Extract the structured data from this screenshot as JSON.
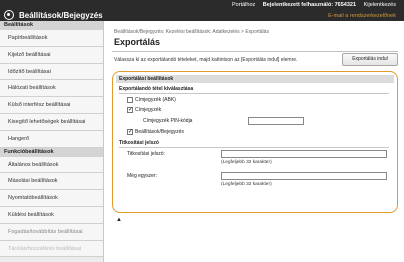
{
  "topbar": {
    "links": [
      "Portálhoz",
      "Bejelentkezett felhasználó: 7654321",
      "Kijelentkezés"
    ],
    "brand": "Beállítások/Bejegyzés",
    "email_link": "E-mail a rendszerkezelőnek"
  },
  "sidebar": {
    "section1": "Beállítások",
    "items1": [
      "Papírbeállítások",
      "Kijelző beállításai",
      "Időzítő beállításai",
      "Hálózati beállítások",
      "Külső interfész beállításai",
      "Kisegítő lehetőségek beállításai",
      "Hangerő"
    ],
    "section2": "Funkcióbeállítások",
    "items2": [
      "Általános beállítások",
      "Másolási beállítások",
      "Nyomtatóbeállítások",
      "Küldési beállítások",
      "Fogadás/továbbítás beállításai",
      "Tárolás/hozzáférés beállításai"
    ]
  },
  "main": {
    "breadcrumb": "Beállítások/Bejegyzés: Kezelési beállítások: Adatkezelés > Exportálás",
    "title": "Exportálás",
    "description": "Válassza ki az exportálandó tételeket, majd kattintson az [Exportálás indul] elemre.",
    "export_button": "Exportálás indul"
  },
  "panel": {
    "section_export": "Exportálási beállítások",
    "subsection_items": "Exportálandó tétel kiválasztása",
    "opt_abk": "Címjegyzék (ABK)",
    "opt_addressbook": "Címjegyzék",
    "pin_label": "Címjegyzék PIN-kódja",
    "opt_settings": "Beállítások/Bejegyzés",
    "subsection_password": "Titkosítási jelszó",
    "pw_label": "Titkosítási jelszó:",
    "pw_hint": "(Legfeljebb 32 karakter)",
    "confirm_label": "Még egyszer:",
    "confirm_hint": "(Legfeljebb 32 karakter)",
    "abk_checked": false,
    "addressbook_checked": true,
    "settings_checked": true
  },
  "colors": {
    "accent": "#e29a2c",
    "topbar": "#2b2b2b"
  }
}
